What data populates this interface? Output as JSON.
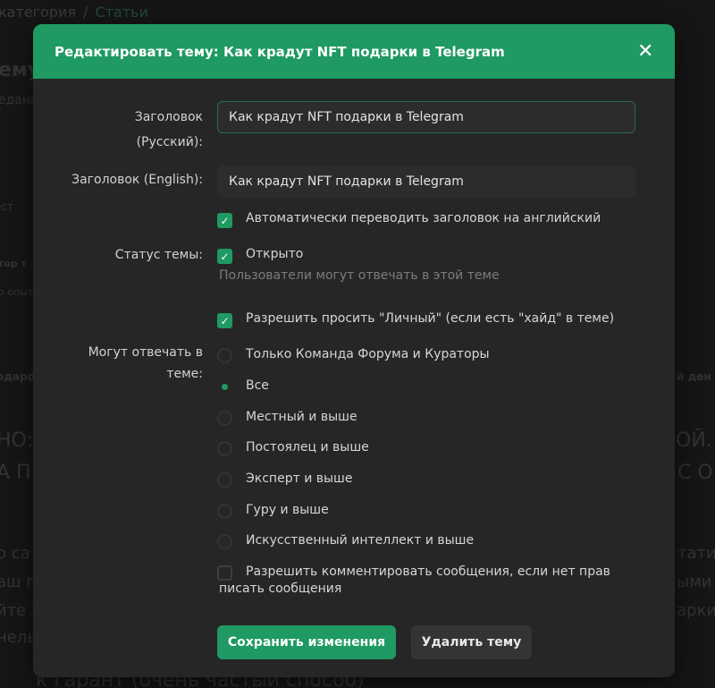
{
  "background": {
    "breadcrumb": [
      "категория",
      "Статьи"
    ],
    "fragments": [
      "ему",
      "едана",
      "ест",
      "тор т",
      "о опыт",
      "одаро",
      "й ден",
      "НО:",
      "ОЙ. I",
      "А П",
      "С О",
      "о са",
      "тати",
      "аш п",
      "ыми а",
      "йте т",
      "арки",
      "нель",
      "к гарант (очень частый способ)"
    ]
  },
  "modal": {
    "title": "Редактировать тему: Как крадут NFT подарки в Telegram",
    "close_icon": "close-icon",
    "fields": {
      "title_ru_label_line1": "Заголовок",
      "title_ru_label_line2": "(Русский):",
      "title_ru_value": "Как крадут NFT подарки в Telegram",
      "title_en_label": "Заголовок (English):",
      "title_en_value": "Как крадут NFT подарки в Telegram",
      "auto_translate_label": "Автоматически переводить заголовок на английский",
      "auto_translate_checked": true,
      "status_label": "Статус темы:",
      "status_open_label": "Открыто",
      "status_open_checked": true,
      "status_hint": "Пользователи могут отвечать в этой теме",
      "allow_private_label": "Разрешить просить \"Личный\" (если есть \"хайд\" в теме)",
      "allow_private_checked": true,
      "reply_label": "Могут отвечать в теме:",
      "reply_options": [
        "Только Команда Форума и Кураторы",
        "Все",
        "Местный и выше",
        "Постоялец и выше",
        "Эксперт и выше",
        "Гуру и выше",
        "Искусственный интеллект и выше"
      ],
      "reply_selected": "Все",
      "allow_comments_label_line1": "Разрешить комментировать сообщения, если нет прав",
      "allow_comments_label_line2": "писать сообщения",
      "allow_comments_checked": false
    },
    "buttons": {
      "save": "Сохранить изменения",
      "delete": "Удалить тему"
    }
  },
  "colors": {
    "accent": "#1e9a62",
    "modal_bg": "#262626",
    "input_bg": "#2c2c2c"
  }
}
